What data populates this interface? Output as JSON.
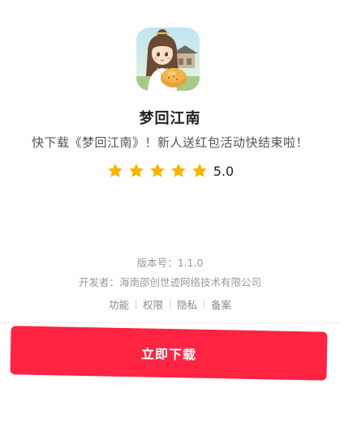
{
  "app": {
    "name": "梦回江南",
    "promo": "快下载《梦回江南》！新人送红包活动快结束啦！",
    "icon": "game-character-icon",
    "rating": {
      "score_text": "5.0",
      "stars": 5,
      "star_color": "#f7b500"
    }
  },
  "info": {
    "version": "版本号：1.1.0",
    "developer": "开发者：海南邵创世迹网络技术有限公司"
  },
  "links": [
    "功能",
    "权限",
    "隐私",
    "备案"
  ],
  "download": {
    "label": "立即下载",
    "color": "#ff2442"
  }
}
